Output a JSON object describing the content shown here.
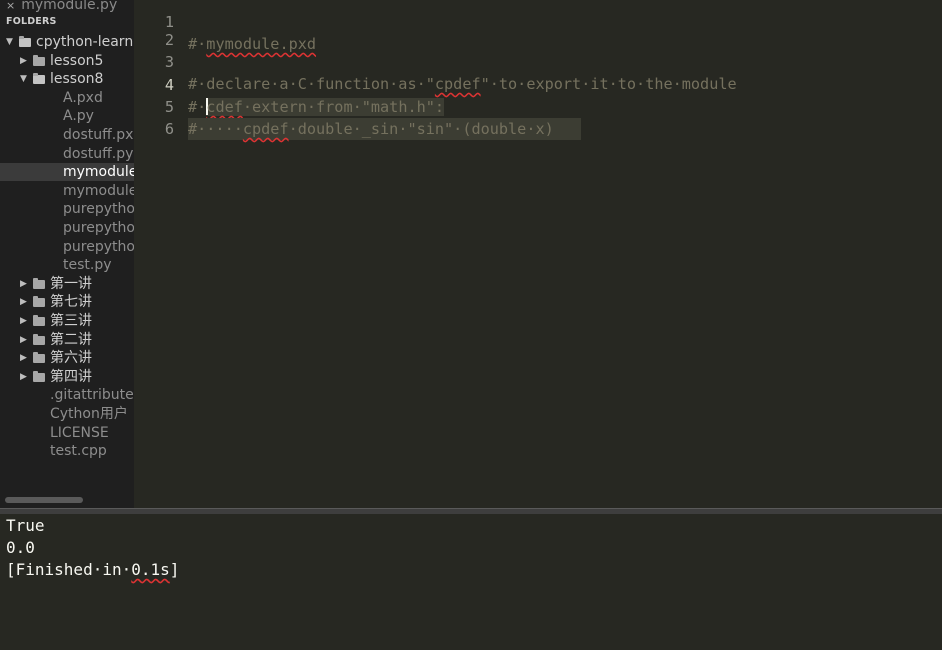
{
  "sidebar": {
    "open_file": {
      "close_glyph": "×",
      "name": "mymodule.py"
    },
    "header": "FOLDERS",
    "tree": [
      {
        "label": "cpython-learn",
        "kind": "folder",
        "expanded": true
      },
      {
        "label": "lesson5",
        "kind": "folder",
        "expanded": false
      },
      {
        "label": "lesson8",
        "kind": "folder",
        "expanded": true
      },
      {
        "label": "A.pxd",
        "kind": "file"
      },
      {
        "label": "A.py",
        "kind": "file"
      },
      {
        "label": "dostuff.px",
        "kind": "file"
      },
      {
        "label": "dostuff.py",
        "kind": "file"
      },
      {
        "label": "mymodule",
        "kind": "file",
        "selected": true
      },
      {
        "label": "mymodule",
        "kind": "file"
      },
      {
        "label": "purepytho",
        "kind": "file"
      },
      {
        "label": "purepytho",
        "kind": "file"
      },
      {
        "label": "purepytho",
        "kind": "file"
      },
      {
        "label": "test.py",
        "kind": "file"
      },
      {
        "label": "第一讲",
        "kind": "folder",
        "expanded": false
      },
      {
        "label": "第七讲",
        "kind": "folder",
        "expanded": false
      },
      {
        "label": "第三讲",
        "kind": "folder",
        "expanded": false
      },
      {
        "label": "第二讲",
        "kind": "folder",
        "expanded": false
      },
      {
        "label": "第六讲",
        "kind": "folder",
        "expanded": false
      },
      {
        "label": "第四讲",
        "kind": "folder",
        "expanded": false
      },
      {
        "label": ".gitattribute",
        "kind": "file"
      },
      {
        "label": "Cython用户",
        "kind": "file"
      },
      {
        "label": "LICENSE",
        "kind": "file"
      },
      {
        "label": "test.cpp",
        "kind": "file"
      }
    ]
  },
  "editor": {
    "lines": [
      {
        "num": "1",
        "text": "#·mymodule.pxd"
      },
      {
        "num": "2",
        "text": ""
      },
      {
        "num": "3",
        "text": "#·declare·a·C·function·as·\"cpdef\"·to·export·it·to·the·module"
      },
      {
        "num": "4",
        "text": "#·cdef·extern·from·\"math.h\":"
      },
      {
        "num": "5",
        "text": "#·····cpdef·double·_sin·\"sin\"·(double·x)"
      },
      {
        "num": "6",
        "text": ""
      }
    ]
  },
  "output": {
    "lines": [
      "True",
      "0.0",
      "[Finished·in·0.1s]"
    ]
  },
  "colors": {
    "background": "#272822",
    "sidebar": "#1f1f1f",
    "comment": "#75715e",
    "selection": "#3c3d33",
    "spell_error": "#dd3333"
  }
}
